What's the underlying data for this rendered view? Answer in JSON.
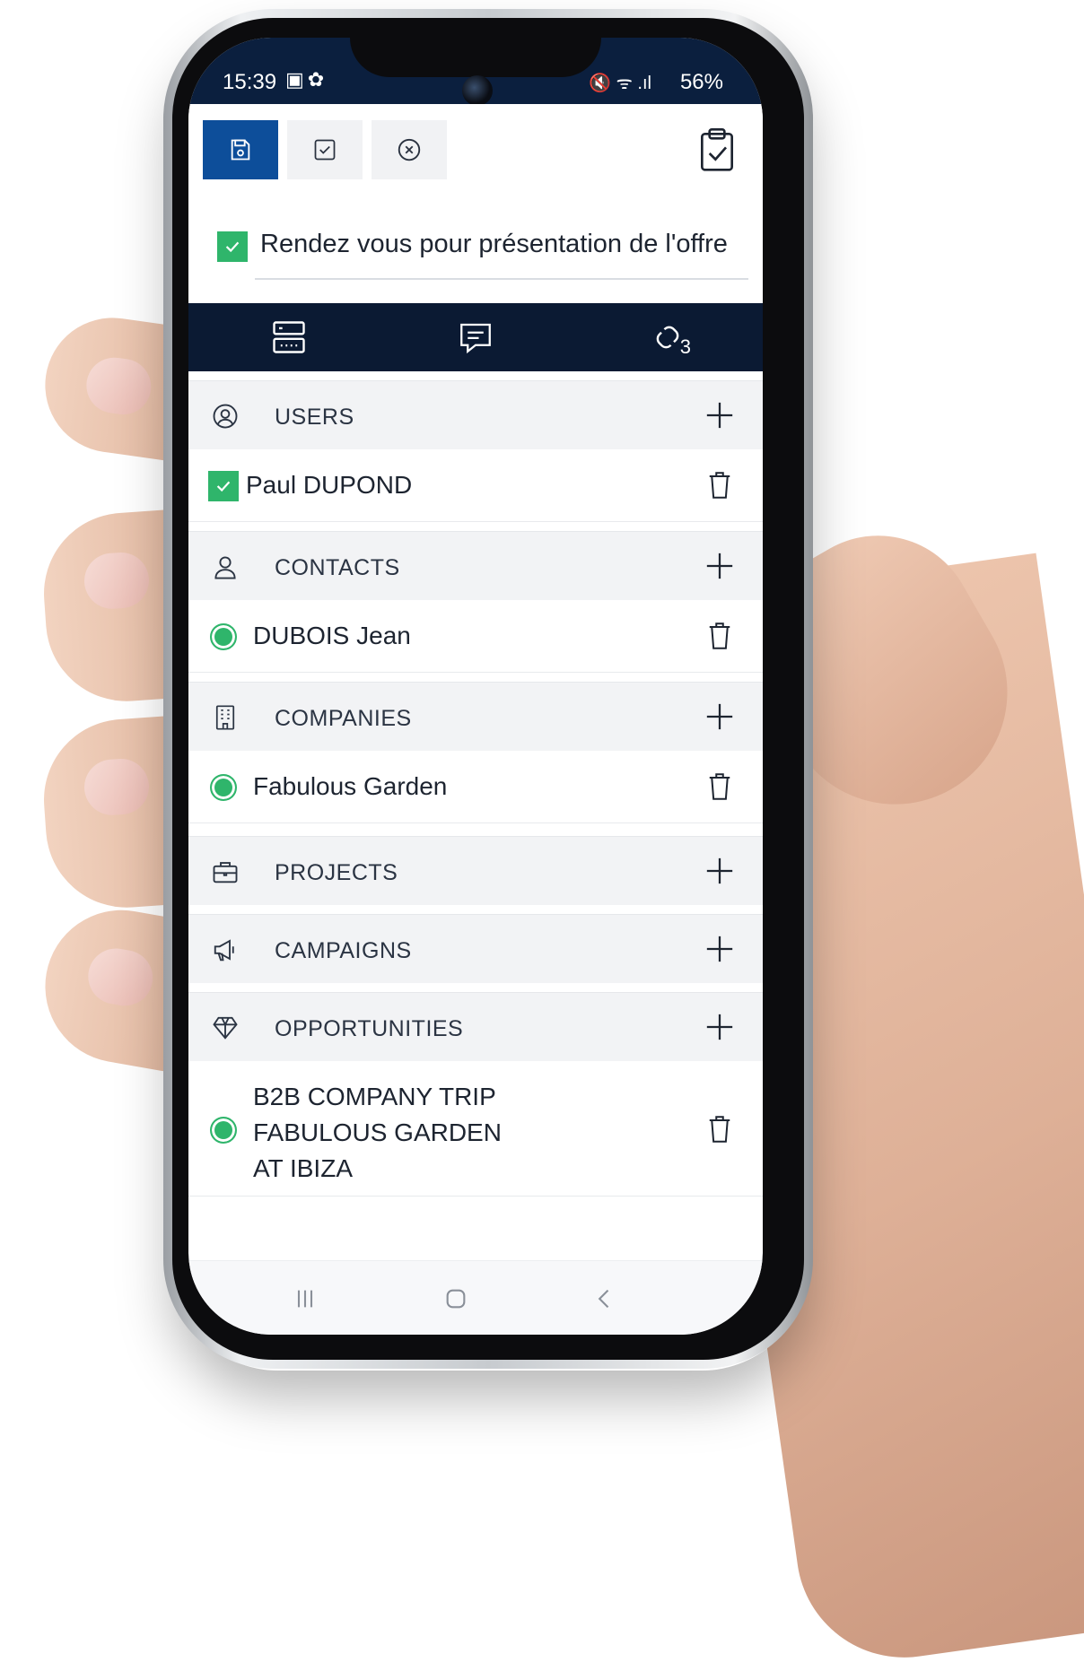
{
  "status_bar": {
    "time": "15:39",
    "battery": "56%"
  },
  "title": {
    "value": "Rendez vous pour présentation de l'offre"
  },
  "sections": {
    "users": {
      "label": "USERS",
      "items": [
        "Paul DUPOND"
      ]
    },
    "contacts": {
      "label": "CONTACTS",
      "items": [
        "DUBOIS Jean"
      ]
    },
    "companies": {
      "label": "COMPANIES",
      "items": [
        "Fabulous Garden"
      ]
    },
    "projects": {
      "label": "PROJECTS"
    },
    "campaigns": {
      "label": "CAMPAIGNS"
    },
    "opportunities": {
      "label": "OPPORTUNITIES",
      "items": [
        "B2B COMPANY TRIP\nFABULOUS GARDEN\nAT IBIZA"
      ]
    }
  },
  "tabs": {
    "links_badge": "3"
  },
  "colors": {
    "primary": "#0d4e9a",
    "navy": "#0b1a33",
    "success": "#2fb56b",
    "section_bg": "#f2f3f5"
  }
}
